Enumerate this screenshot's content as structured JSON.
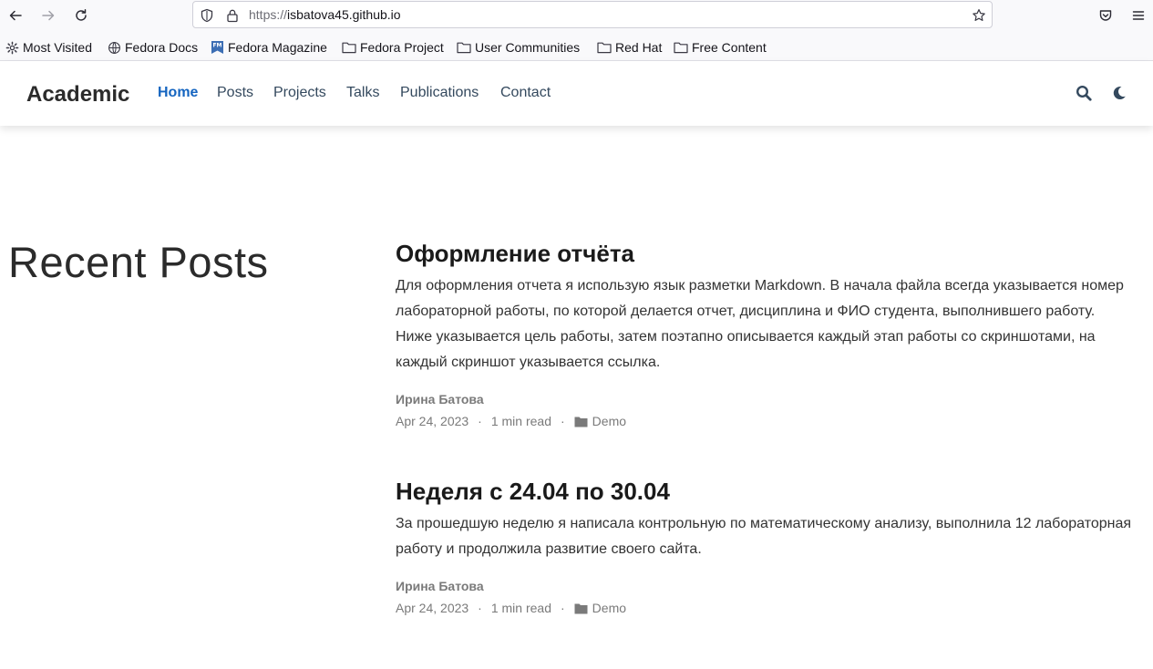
{
  "browser": {
    "url_protocol": "https://",
    "url_host": "isbatova45.github.io",
    "bookmarks": [
      {
        "label": "Most Visited",
        "icon": "gear-icon"
      },
      {
        "label": "Fedora Docs",
        "icon": "globe-icon"
      },
      {
        "label": "Fedora Magazine",
        "icon": "fedora-magazine-icon"
      },
      {
        "label": "Fedora Project",
        "icon": "folder-icon"
      },
      {
        "label": "User Communities",
        "icon": "folder-icon"
      },
      {
        "label": "Red Hat",
        "icon": "folder-icon"
      },
      {
        "label": "Free Content",
        "icon": "folder-icon"
      }
    ]
  },
  "site": {
    "brand": "Academic",
    "nav": [
      "Home",
      "Posts",
      "Projects",
      "Talks",
      "Publications",
      "Contact"
    ],
    "active_nav": "Home",
    "accent_color": "#1565c0"
  },
  "main": {
    "section_title": "Recent Posts",
    "posts": [
      {
        "title": "Оформление отчёта",
        "summary": "Для оформления отчета я использую язык разметки Markdown. В начала файла всегда указывается номер лабораторной работы, по которой делается отчет, дисциплина и ФИО студента, выполнившего работу. Ниже указывается цель работы, затем поэтапно описывается каждый этап работы со скриншотами, на каждый скриншот указывается ссылка.",
        "author": "Ирина Батова",
        "date": "Apr 24, 2023",
        "read_time": "1 min read",
        "category": "Demo"
      },
      {
        "title": "Неделя с 24.04 по 30.04",
        "summary": "За прошедшую неделю я написала контрольную по математическому анализу, выполнила 12 лабораторная работу и продолжила развитие своего сайта.",
        "author": "Ирина Батова",
        "date": "Apr 24, 2023",
        "read_time": "1 min read",
        "category": "Demo"
      }
    ]
  }
}
